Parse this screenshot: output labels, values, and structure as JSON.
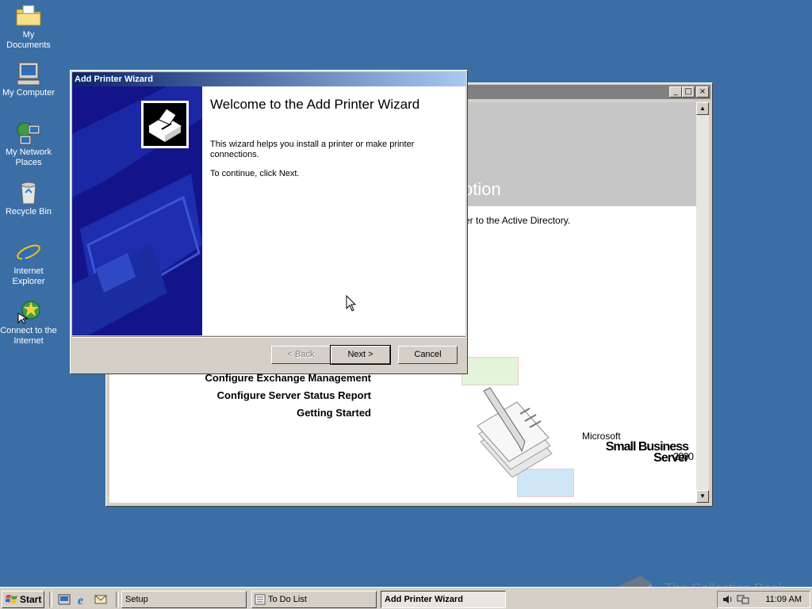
{
  "desktop": {
    "icons": [
      {
        "label": "My Documents"
      },
      {
        "label": "My Computer"
      },
      {
        "label": "My Network Places"
      },
      {
        "label": "Recycle Bin"
      },
      {
        "label": "Internet Explorer"
      },
      {
        "label": "Connect to the Internet"
      }
    ]
  },
  "background_window": {
    "heading_fragment": "otion",
    "description_fragment": "er to the Active Directory.",
    "links": [
      "Configure Exchange Management",
      "Configure Server Status Report",
      "Getting Started"
    ],
    "logo_brand": "Microsoft",
    "logo_product": "Small Business Server",
    "logo_version": "2000",
    "window_buttons": {
      "minimize": "_",
      "maximize": "□",
      "close": "×"
    }
  },
  "wizard": {
    "title": "Add Printer Wizard",
    "heading": "Welcome to the Add Printer Wizard",
    "text1": "This wizard helps you install a printer or make printer connections.",
    "text2": "To continue, click Next.",
    "back_label": "< Back",
    "next_label": "Next >",
    "cancel_label": "Cancel"
  },
  "taskbar": {
    "start_label": "Start",
    "tasks": [
      {
        "label": "Setup",
        "active": false
      },
      {
        "label": "To Do List",
        "active": false
      },
      {
        "label": "Add Printer Wizard",
        "active": true
      }
    ],
    "clock": "11:09 AM"
  },
  "watermark": {
    "text": "The Collection Book"
  },
  "colors": {
    "desktop": "#3a6ea5",
    "title_active": "#0a246a",
    "title_inactive": "#808080",
    "wizard_side": "#1a1a8c"
  }
}
